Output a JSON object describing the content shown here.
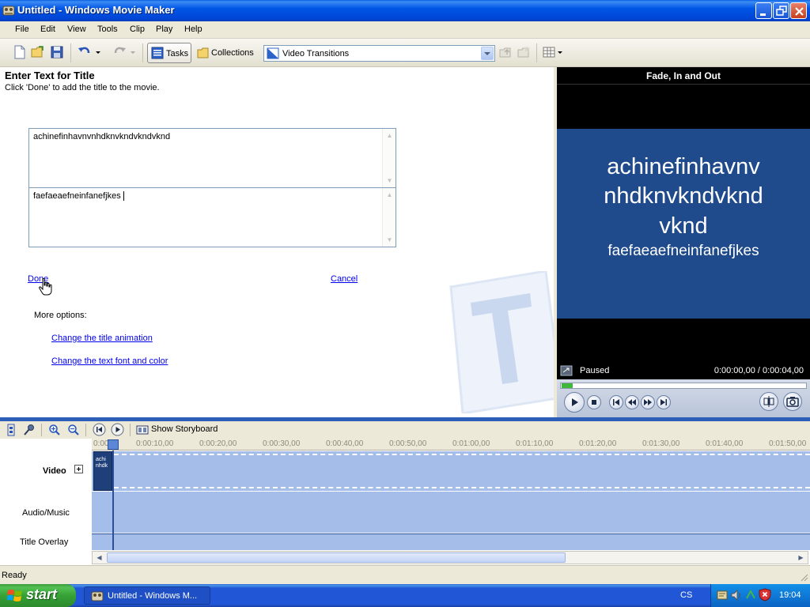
{
  "window": {
    "title": "Untitled - Windows Movie Maker",
    "controls": [
      "minimize-icon",
      "restore-icon",
      "close-icon"
    ]
  },
  "menu": {
    "items": [
      "File",
      "Edit",
      "View",
      "Tools",
      "Clip",
      "Play",
      "Help"
    ]
  },
  "toolbar": {
    "tasks_label": "Tasks",
    "collections_label": "Collections",
    "collection_dropdown_value": "Video Transitions"
  },
  "title_task": {
    "heading": "Enter Text for Title",
    "instruction": "Click 'Done' to add the title to the movie.",
    "line1_text": "achinefinhavnvnhdknvkndvkndvknd",
    "line2_text": "faefaeaefneinfanefjkes",
    "done_label": "Done",
    "cancel_label": "Cancel",
    "more_options_label": "More options:",
    "option_animation": "Change the title animation",
    "option_font": "Change the text font and color"
  },
  "preview": {
    "title": "Fade, In and Out",
    "screen_line1": "achinefinhavnv",
    "screen_line2": "nhdknvkndvknd",
    "screen_line3": "vknd",
    "screen_line4": "faefaeaefneinfanefjkes",
    "status": "Paused",
    "time": "0:00:00,00 / 0:00:04,00"
  },
  "timeline": {
    "show_storyboard_label": "Show Storyboard",
    "ruler_ticks": [
      "0:00",
      "0:00:10,00",
      "0:00:20,00",
      "0:00:30,00",
      "0:00:40,00",
      "0:00:50,00",
      "0:01:00,00",
      "0:01:10,00",
      "0:01:20,00",
      "0:01:30,00",
      "0:01:40,00",
      "0:01:50,00"
    ],
    "tracks": {
      "video": "Video",
      "audio": "Audio/Music",
      "title_overlay": "Title Overlay"
    },
    "clip_text_line1": "achi",
    "clip_text_line2": "nhdk"
  },
  "statusbar": {
    "text": "Ready"
  },
  "taskbar": {
    "start_label": "start",
    "task_item_label": "Untitled - Windows M...",
    "language": "CS",
    "clock": "19:04"
  }
}
